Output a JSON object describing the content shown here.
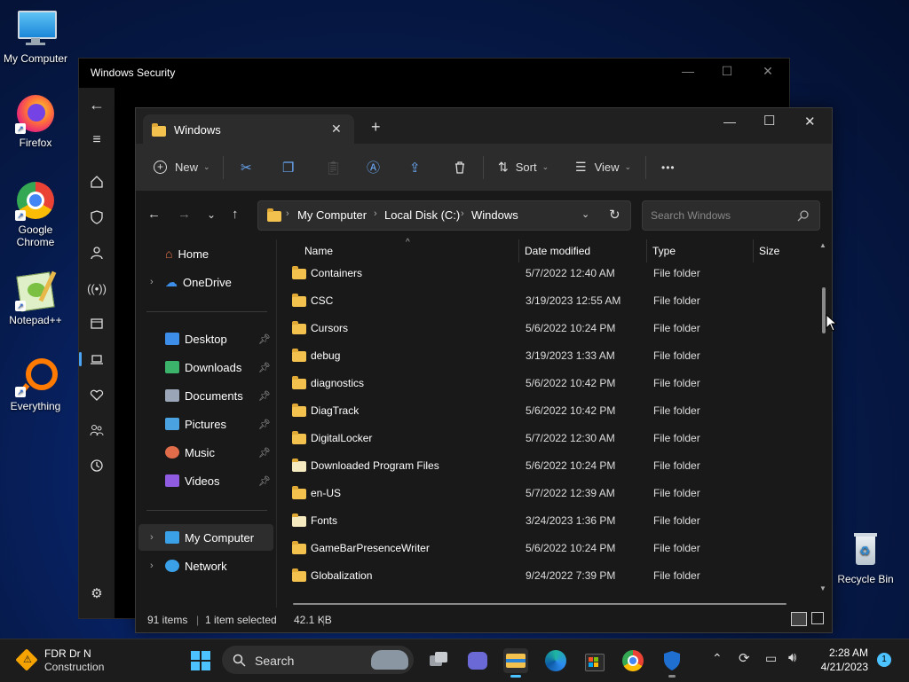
{
  "desktop": {
    "icons": [
      {
        "label": "My Computer"
      },
      {
        "label": "Firefox"
      },
      {
        "label": "Google Chrome"
      },
      {
        "label": "Notepad++"
      },
      {
        "label": "Everything"
      },
      {
        "label": "Recycle Bin"
      }
    ]
  },
  "security_window": {
    "title": "Windows Security",
    "rail_icons": [
      "back-arrow-icon",
      "hamburger-icon",
      "home-icon",
      "shield-icon",
      "person-icon",
      "wireless-icon",
      "app-browser-icon",
      "laptop-icon",
      "heart-icon",
      "family-icon",
      "history-icon",
      "gear-icon"
    ]
  },
  "explorer": {
    "tab_title": "Windows",
    "toolbar": {
      "new_label": "New",
      "sort_label": "Sort",
      "view_label": "View",
      "more_label": "•••"
    },
    "breadcrumb": [
      "My Computer",
      "Local Disk (C:)",
      "Windows"
    ],
    "search_placeholder": "Search Windows",
    "nav": {
      "home": "Home",
      "onedrive": "OneDrive",
      "quick": [
        {
          "label": "Desktop",
          "color": "#3d8ee8"
        },
        {
          "label": "Downloads",
          "color": "#3bb36b"
        },
        {
          "label": "Documents",
          "color": "#9aa6b8"
        },
        {
          "label": "Pictures",
          "color": "#4aa3e0"
        },
        {
          "label": "Music",
          "color": "#e06c4a"
        },
        {
          "label": "Videos",
          "color": "#8f5be0"
        }
      ],
      "my_computer": "My Computer",
      "network": "Network"
    },
    "columns": {
      "name": "Name",
      "date": "Date modified",
      "type": "Type",
      "size": "Size"
    },
    "rows": [
      {
        "name": "Containers",
        "date": "5/7/2022 12:40 AM",
        "type": "File folder"
      },
      {
        "name": "CSC",
        "date": "3/19/2023 12:55 AM",
        "type": "File folder"
      },
      {
        "name": "Cursors",
        "date": "5/6/2022 10:24 PM",
        "type": "File folder"
      },
      {
        "name": "debug",
        "date": "3/19/2023 1:33 AM",
        "type": "File folder"
      },
      {
        "name": "diagnostics",
        "date": "5/6/2022 10:42 PM",
        "type": "File folder"
      },
      {
        "name": "DiagTrack",
        "date": "5/6/2022 10:42 PM",
        "type": "File folder"
      },
      {
        "name": "DigitalLocker",
        "date": "5/7/2022 12:30 AM",
        "type": "File folder"
      },
      {
        "name": "Downloaded Program Files",
        "date": "5/6/2022 10:24 PM",
        "type": "File folder"
      },
      {
        "name": "en-US",
        "date": "5/7/2022 12:39 AM",
        "type": "File folder"
      },
      {
        "name": "Fonts",
        "date": "3/24/2023 1:36 PM",
        "type": "File folder"
      },
      {
        "name": "GameBarPresenceWriter",
        "date": "5/6/2022 10:24 PM",
        "type": "File folder"
      },
      {
        "name": "Globalization",
        "date": "9/24/2022 7:39 PM",
        "type": "File folder"
      }
    ],
    "status": {
      "items": "91 items",
      "selected": "1 item selected",
      "size": "42.1 KB",
      "divider": "|"
    }
  },
  "taskbar": {
    "weather_title": "FDR Dr N",
    "weather_sub": "Construction",
    "search_label": "Search",
    "time": "2:28 AM",
    "date": "4/21/2023",
    "notification_count": "1"
  }
}
